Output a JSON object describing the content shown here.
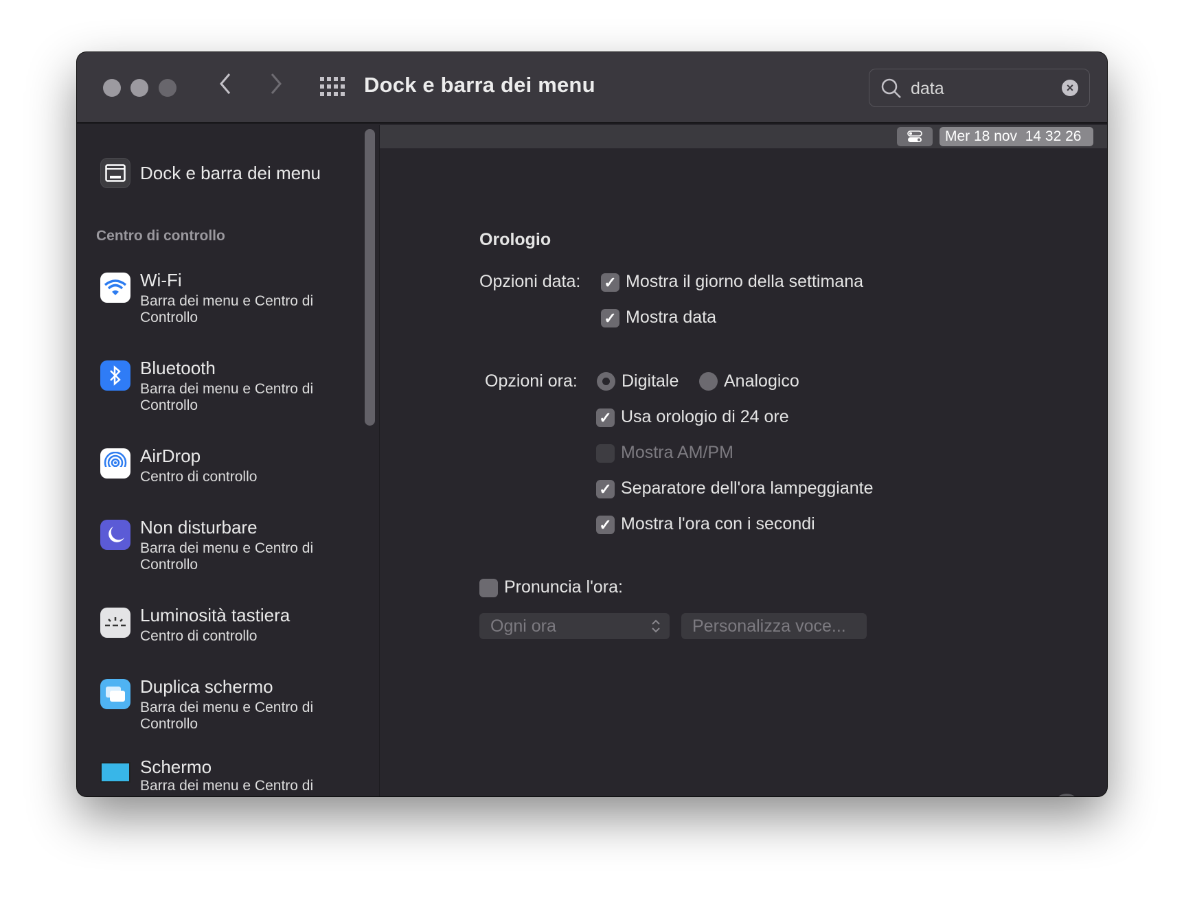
{
  "window": {
    "title": "Dock e barra dei menu"
  },
  "search": {
    "value": "data"
  },
  "sidebar": {
    "top_item": "Dock e barra dei menu",
    "section_header": "Centro di controllo",
    "items": [
      {
        "title": "Wi-Fi",
        "subtitle": "Barra dei menu e Centro di Controllo",
        "icon": "wifi-icon",
        "color": "#ffffff"
      },
      {
        "title": "Bluetooth",
        "subtitle": "Barra dei menu e Centro di Controllo",
        "icon": "bluetooth-icon",
        "color": "#2f7cf6"
      },
      {
        "title": "AirDrop",
        "subtitle": "Centro di controllo",
        "icon": "airdrop-icon",
        "color": "#ffffff"
      },
      {
        "title": "Non disturbare",
        "subtitle": "Barra dei menu e Centro di Controllo",
        "icon": "moon-icon",
        "color": "#5b5bd6"
      },
      {
        "title": "Luminosità tastiera",
        "subtitle": "Centro di controllo",
        "icon": "keyboard-brightness-icon",
        "color": "#e4e4e6"
      },
      {
        "title": "Duplica schermo",
        "subtitle": "Barra dei menu e Centro di Controllo",
        "icon": "screen-mirroring-icon",
        "color": "#4fb3f3"
      },
      {
        "title": "Schermo",
        "subtitle": "Barra dei menu e Centro di",
        "icon": "display-icon",
        "color": "#38b6e8"
      }
    ]
  },
  "menubar_preview": {
    "clock": "Mer 18 nov  14 32 26"
  },
  "clock": {
    "section_title": "Orologio",
    "date_options_label": "Opzioni data:",
    "show_weekday": {
      "label": "Mostra il giorno della settimana",
      "checked": true
    },
    "show_date": {
      "label": "Mostra data",
      "checked": true
    },
    "time_options_label": "Opzioni ora:",
    "digital": {
      "label": "Digitale",
      "selected": true
    },
    "analog": {
      "label": "Analogico",
      "selected": false
    },
    "use_24h": {
      "label": "Usa orologio di 24 ore",
      "checked": true
    },
    "show_ampm": {
      "label": "Mostra AM/PM",
      "checked": false,
      "disabled": true
    },
    "flash_separator": {
      "label": "Separatore dell'ora lampeggiante",
      "checked": true
    },
    "show_seconds": {
      "label": "Mostra l'ora con i secondi",
      "checked": true
    },
    "announce": {
      "label": "Pronuncia l'ora:",
      "checked": false
    },
    "interval_select": "Ogni ora",
    "customize_voice": "Personalizza voce...",
    "help": "?"
  }
}
